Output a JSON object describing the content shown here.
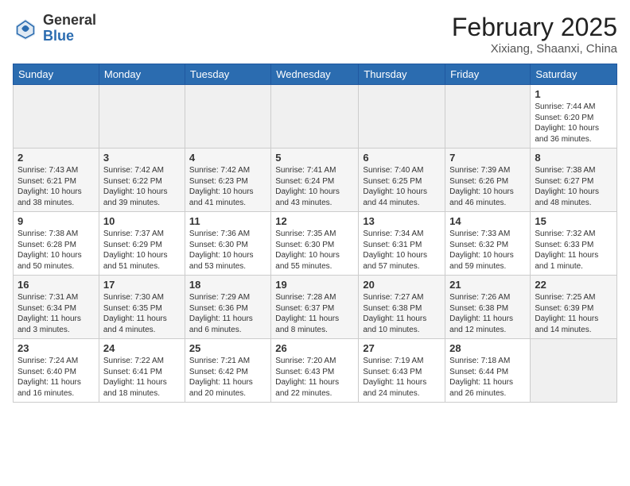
{
  "header": {
    "logo_general": "General",
    "logo_blue": "Blue",
    "month_title": "February 2025",
    "subtitle": "Xixiang, Shaanxi, China"
  },
  "days_of_week": [
    "Sunday",
    "Monday",
    "Tuesday",
    "Wednesday",
    "Thursday",
    "Friday",
    "Saturday"
  ],
  "weeks": [
    [
      {
        "day": "",
        "info": ""
      },
      {
        "day": "",
        "info": ""
      },
      {
        "day": "",
        "info": ""
      },
      {
        "day": "",
        "info": ""
      },
      {
        "day": "",
        "info": ""
      },
      {
        "day": "",
        "info": ""
      },
      {
        "day": "1",
        "info": "Sunrise: 7:44 AM\nSunset: 6:20 PM\nDaylight: 10 hours and 36 minutes."
      }
    ],
    [
      {
        "day": "2",
        "info": "Sunrise: 7:43 AM\nSunset: 6:21 PM\nDaylight: 10 hours and 38 minutes."
      },
      {
        "day": "3",
        "info": "Sunrise: 7:42 AM\nSunset: 6:22 PM\nDaylight: 10 hours and 39 minutes."
      },
      {
        "day": "4",
        "info": "Sunrise: 7:42 AM\nSunset: 6:23 PM\nDaylight: 10 hours and 41 minutes."
      },
      {
        "day": "5",
        "info": "Sunrise: 7:41 AM\nSunset: 6:24 PM\nDaylight: 10 hours and 43 minutes."
      },
      {
        "day": "6",
        "info": "Sunrise: 7:40 AM\nSunset: 6:25 PM\nDaylight: 10 hours and 44 minutes."
      },
      {
        "day": "7",
        "info": "Sunrise: 7:39 AM\nSunset: 6:26 PM\nDaylight: 10 hours and 46 minutes."
      },
      {
        "day": "8",
        "info": "Sunrise: 7:38 AM\nSunset: 6:27 PM\nDaylight: 10 hours and 48 minutes."
      }
    ],
    [
      {
        "day": "9",
        "info": "Sunrise: 7:38 AM\nSunset: 6:28 PM\nDaylight: 10 hours and 50 minutes."
      },
      {
        "day": "10",
        "info": "Sunrise: 7:37 AM\nSunset: 6:29 PM\nDaylight: 10 hours and 51 minutes."
      },
      {
        "day": "11",
        "info": "Sunrise: 7:36 AM\nSunset: 6:30 PM\nDaylight: 10 hours and 53 minutes."
      },
      {
        "day": "12",
        "info": "Sunrise: 7:35 AM\nSunset: 6:30 PM\nDaylight: 10 hours and 55 minutes."
      },
      {
        "day": "13",
        "info": "Sunrise: 7:34 AM\nSunset: 6:31 PM\nDaylight: 10 hours and 57 minutes."
      },
      {
        "day": "14",
        "info": "Sunrise: 7:33 AM\nSunset: 6:32 PM\nDaylight: 10 hours and 59 minutes."
      },
      {
        "day": "15",
        "info": "Sunrise: 7:32 AM\nSunset: 6:33 PM\nDaylight: 11 hours and 1 minute."
      }
    ],
    [
      {
        "day": "16",
        "info": "Sunrise: 7:31 AM\nSunset: 6:34 PM\nDaylight: 11 hours and 3 minutes."
      },
      {
        "day": "17",
        "info": "Sunrise: 7:30 AM\nSunset: 6:35 PM\nDaylight: 11 hours and 4 minutes."
      },
      {
        "day": "18",
        "info": "Sunrise: 7:29 AM\nSunset: 6:36 PM\nDaylight: 11 hours and 6 minutes."
      },
      {
        "day": "19",
        "info": "Sunrise: 7:28 AM\nSunset: 6:37 PM\nDaylight: 11 hours and 8 minutes."
      },
      {
        "day": "20",
        "info": "Sunrise: 7:27 AM\nSunset: 6:38 PM\nDaylight: 11 hours and 10 minutes."
      },
      {
        "day": "21",
        "info": "Sunrise: 7:26 AM\nSunset: 6:38 PM\nDaylight: 11 hours and 12 minutes."
      },
      {
        "day": "22",
        "info": "Sunrise: 7:25 AM\nSunset: 6:39 PM\nDaylight: 11 hours and 14 minutes."
      }
    ],
    [
      {
        "day": "23",
        "info": "Sunrise: 7:24 AM\nSunset: 6:40 PM\nDaylight: 11 hours and 16 minutes."
      },
      {
        "day": "24",
        "info": "Sunrise: 7:22 AM\nSunset: 6:41 PM\nDaylight: 11 hours and 18 minutes."
      },
      {
        "day": "25",
        "info": "Sunrise: 7:21 AM\nSunset: 6:42 PM\nDaylight: 11 hours and 20 minutes."
      },
      {
        "day": "26",
        "info": "Sunrise: 7:20 AM\nSunset: 6:43 PM\nDaylight: 11 hours and 22 minutes."
      },
      {
        "day": "27",
        "info": "Sunrise: 7:19 AM\nSunset: 6:43 PM\nDaylight: 11 hours and 24 minutes."
      },
      {
        "day": "28",
        "info": "Sunrise: 7:18 AM\nSunset: 6:44 PM\nDaylight: 11 hours and 26 minutes."
      },
      {
        "day": "",
        "info": ""
      }
    ]
  ]
}
